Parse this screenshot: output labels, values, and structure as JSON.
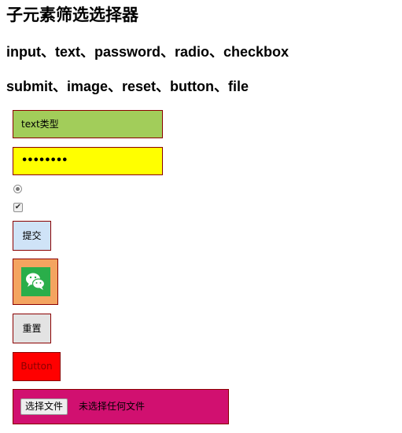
{
  "headings": {
    "title": "子元素筛选选择器",
    "line1": "input、text、password、radio、checkbox",
    "line2": "submit、image、reset、button、file"
  },
  "form": {
    "text_value": "text类型",
    "password_mask": "••••••••",
    "radio_checked": true,
    "checkbox_checked": true,
    "submit_label": "提交",
    "image_icon": "wechat-icon",
    "reset_label": "重置",
    "button_label": "Button",
    "file_button_label": "选择文件",
    "file_status": "未选择任何文件"
  },
  "colors": {
    "text_bg": "#a2cd5a",
    "password_bg": "#ffff00",
    "submit_bg": "#cfe3f7",
    "image_bg": "#f4a460",
    "reset_bg": "#e3e3e3",
    "button_bg": "#ff0000",
    "file_bg": "#d11070",
    "border": "#8b0000"
  }
}
